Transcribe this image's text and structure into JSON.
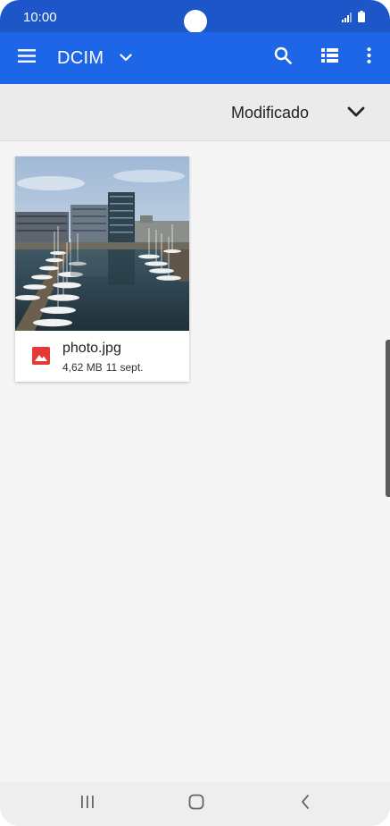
{
  "status_bar": {
    "time": "10:00",
    "signal_icon": "signal-icon",
    "battery_icon": "battery-icon"
  },
  "app_bar": {
    "menu_icon": "menu-icon",
    "folder_title": "DCIM",
    "folder_dropdown_icon": "chevron-down-icon",
    "search_icon": "search-icon",
    "view_icon": "list-view-icon",
    "more_icon": "more-vert-icon"
  },
  "sort_bar": {
    "label": "Modificado",
    "direction_icon": "chevron-down-icon"
  },
  "files": [
    {
      "name": "photo.jpg",
      "size": "4,62 MB",
      "date": "11 sept.",
      "type_icon": "image-icon"
    }
  ],
  "nav_bar": {
    "recents_icon": "recents-icon",
    "home_icon": "home-icon",
    "back_icon": "back-icon"
  },
  "colors": {
    "status_bar": "#1d56c8",
    "app_bar": "#1d66e8",
    "sort_bar": "#ebebeb",
    "background": "#f5f5f5",
    "image_icon": "#e53935"
  }
}
